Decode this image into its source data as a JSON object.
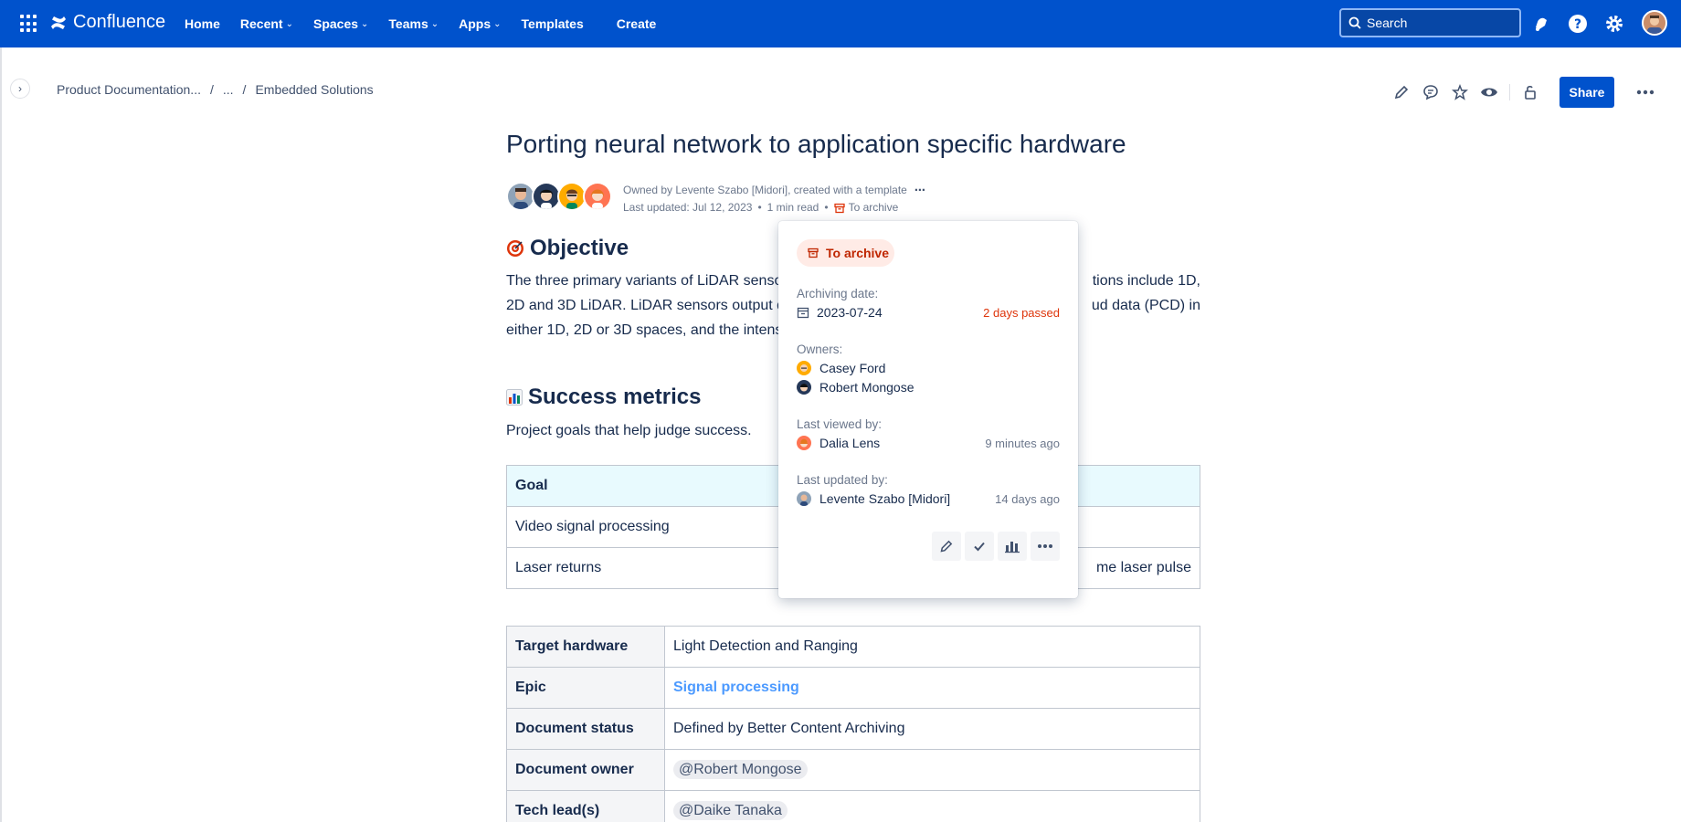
{
  "topbar": {
    "logo_text": "Confluence",
    "nav": [
      {
        "label": "Home",
        "dropdown": false
      },
      {
        "label": "Recent",
        "dropdown": true
      },
      {
        "label": "Spaces",
        "dropdown": true
      },
      {
        "label": "Teams",
        "dropdown": true
      },
      {
        "label": "Apps",
        "dropdown": true
      },
      {
        "label": "Templates",
        "dropdown": false
      }
    ],
    "create_label": "Create",
    "search_placeholder": "Search",
    "accent_color": "#0052cc",
    "icons": [
      "notifications-icon",
      "help-icon",
      "settings-icon"
    ]
  },
  "breadcrumb": {
    "items": [
      "Product Documentation...",
      "...",
      "Embedded Solutions"
    ],
    "separator": "/"
  },
  "page_actions": {
    "icons": [
      "edit-icon",
      "comment-icon",
      "star-icon",
      "watch-icon",
      "restrictions-icon"
    ],
    "share_label": "Share"
  },
  "page": {
    "title": "Porting neural network to application specific hardware",
    "owned_by": "Owned by Levente Szabo [Midori], created with a template",
    "last_updated": "Last updated: Jul 12, 2023",
    "read_time": "1 min read",
    "archive_status": "To archive",
    "bullet": "•"
  },
  "objective": {
    "heading": "Objective",
    "text_line1": "The three primary variants of LiDAR sensor",
    "text_line1_end": "tions include 1D,",
    "text_line2": "2D and 3D LiDAR. LiDAR sensors output da",
    "text_line2_end": "ud data (PCD) in",
    "text_line3": "either 1D, 2D or 3D spaces, and the intensi"
  },
  "success_metrics": {
    "heading": "Success metrics",
    "text": "Project goals that help judge success.",
    "table_header": "Goal",
    "rows": [
      "Video signal processing",
      "Laser returns"
    ],
    "row2_trailing": "me laser pulse"
  },
  "properties": {
    "rows": [
      {
        "key": "Target hardware",
        "value": "Light Detection and Ranging"
      },
      {
        "key": "Epic",
        "value": "Signal processing"
      },
      {
        "key": "Document status",
        "value": "Defined by Better Content Archiving"
      },
      {
        "key": "Document owner",
        "value": "@Robert Mongose"
      },
      {
        "key": "Tech lead(s)",
        "value": "@Daike Tanaka"
      }
    ]
  },
  "popup": {
    "status": "To archive",
    "archiving_date_label": "Archiving date:",
    "archiving_date": "2023-07-24",
    "archiving_note": "2 days passed",
    "owners_label": "Owners:",
    "owners": [
      "Casey Ford",
      "Robert Mongose"
    ],
    "last_viewed_label": "Last viewed by:",
    "last_viewed_name": "Dalia Lens",
    "last_viewed_time": "9 minutes ago",
    "last_updated_label": "Last updated by:",
    "last_updated_name": "Levente Szabo [Midori]",
    "last_updated_time": "14 days ago",
    "actions": [
      "edit-icon",
      "check-icon",
      "chart-icon",
      "more-icon"
    ]
  }
}
